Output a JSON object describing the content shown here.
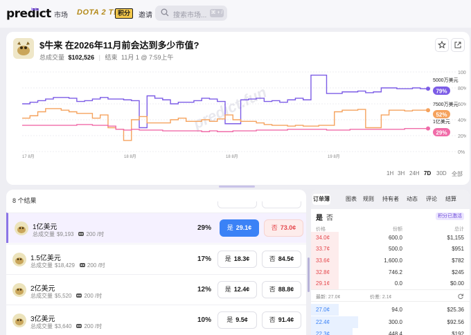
{
  "nav": {
    "logo": "predict",
    "logo_badge": "beta",
    "links": [
      "市场",
      "邀请"
    ],
    "dota": "DOTA 2 T!",
    "points": "积分",
    "search_placeholder": "搜索市场...",
    "search_kbd": "⌘ + /"
  },
  "market": {
    "title": "$牛来 在2026年11月前会达到多少市值?",
    "volume_label": "总成交量",
    "volume": "$102,526",
    "end_label": "结束",
    "end": "11月 1 @ 7:59上午"
  },
  "chart_data": {
    "type": "line",
    "x_ticks": [
      "17 8月",
      "18 8月",
      "18 8月",
      "19 8月"
    ],
    "y_ticks": [
      "100%",
      "80%",
      "60%",
      "40%",
      "20%",
      "0%"
    ],
    "ylim": [
      0,
      100
    ],
    "watermark": "predict.fun",
    "series": [
      {
        "name": "5000万美元",
        "value_label": "79%",
        "color": "#7c5ce6",
        "values": [
          60,
          62,
          64,
          66,
          68,
          68,
          67,
          63,
          64,
          66,
          68,
          66,
          66,
          65,
          64,
          30,
          70,
          67,
          65,
          60,
          62,
          62,
          64,
          67,
          66,
          63,
          35,
          35,
          65,
          66,
          67,
          63,
          64,
          62,
          65,
          67,
          65,
          96,
          96,
          73,
          73,
          75,
          75,
          76,
          74,
          75,
          80,
          80,
          79,
          79,
          80,
          79,
          79
        ]
      },
      {
        "name": "7500万美元",
        "value_label": "52%",
        "color": "#f5a25d",
        "values": [
          42,
          45,
          50,
          54,
          54,
          52,
          50,
          48,
          48,
          42,
          46,
          30,
          28,
          14,
          40,
          44,
          36,
          36,
          36,
          40,
          42,
          38,
          38,
          40,
          38,
          41,
          46,
          40,
          38,
          38,
          36,
          34,
          33,
          33,
          32,
          33,
          32,
          32,
          33,
          33,
          50,
          52,
          52,
          53,
          30,
          30,
          46,
          52,
          52,
          51,
          52,
          52,
          52
        ]
      },
      {
        "name": "1亿美元",
        "value_label": "29%",
        "color": "#f06ba8",
        "values": [
          33,
          33,
          33,
          33,
          33,
          33,
          33,
          34,
          34,
          33,
          33,
          32,
          28,
          27,
          28,
          27,
          27,
          27,
          26,
          26,
          26,
          26,
          26,
          25,
          26,
          25,
          25,
          26,
          26,
          26,
          27,
          27,
          27,
          27,
          28,
          28,
          28,
          28,
          28,
          27,
          27,
          27,
          28,
          28,
          28,
          28,
          28,
          28,
          28,
          29,
          29,
          29,
          29
        ]
      }
    ]
  },
  "ranges": [
    "1H",
    "3H",
    "24H",
    "7D",
    "30D",
    "全部"
  ],
  "active_range": "7D",
  "list": {
    "count": "8 个结果",
    "rows": [
      {
        "name": "1亿美元",
        "vol_label": "总成交量",
        "vol": "$9,193",
        "rate": "200 /时",
        "pct": "29%",
        "yes": "29.1¢",
        "no": "73.0¢",
        "selected": true
      },
      {
        "name": "1.5亿美元",
        "vol_label": "总成交量",
        "vol": "$18,429",
        "rate": "200 /时",
        "pct": "17%",
        "yes": "18.3¢",
        "no": "84.5¢"
      },
      {
        "name": "2亿美元",
        "vol_label": "总成交量",
        "vol": "$5,520",
        "rate": "200 /时",
        "pct": "12%",
        "yes": "12.4¢",
        "no": "88.8¢"
      },
      {
        "name": "3亿美元",
        "vol_label": "总成交量",
        "vol": "$3,640",
        "rate": "200 /时",
        "pct": "10%",
        "yes": "9.5¢",
        "no": "91.4¢"
      }
    ],
    "yes_label": "是",
    "no_label": "否"
  },
  "book": {
    "tabs": [
      "订单薄",
      "图表",
      "规则",
      "持有者",
      "动态",
      "评论",
      "结算"
    ],
    "yes": "是",
    "no": "否",
    "badge": "积分已激活",
    "headers": [
      "价格",
      "份额",
      "总计"
    ],
    "asks": [
      {
        "p": "34.0¢",
        "q": "600.0",
        "t": "$1,155"
      },
      {
        "p": "33.7¢",
        "q": "500.0",
        "t": "$951"
      },
      {
        "p": "33.6¢",
        "q": "1,600.0",
        "t": "$782"
      },
      {
        "p": "32.8¢",
        "q": "746.2",
        "t": "$245"
      },
      {
        "p": "29.1¢",
        "q": "0.0",
        "t": "$0.00"
      }
    ],
    "last": "最新: 27.0¢",
    "spread": "价差: 2.1¢",
    "bids": [
      {
        "p": "27.0¢",
        "q": "94.0",
        "t": "$25.36"
      },
      {
        "p": "22.4¢",
        "q": "300.0",
        "t": "$92.56"
      },
      {
        "p": "22.3¢",
        "q": "448.4",
        "t": "$192"
      }
    ]
  }
}
